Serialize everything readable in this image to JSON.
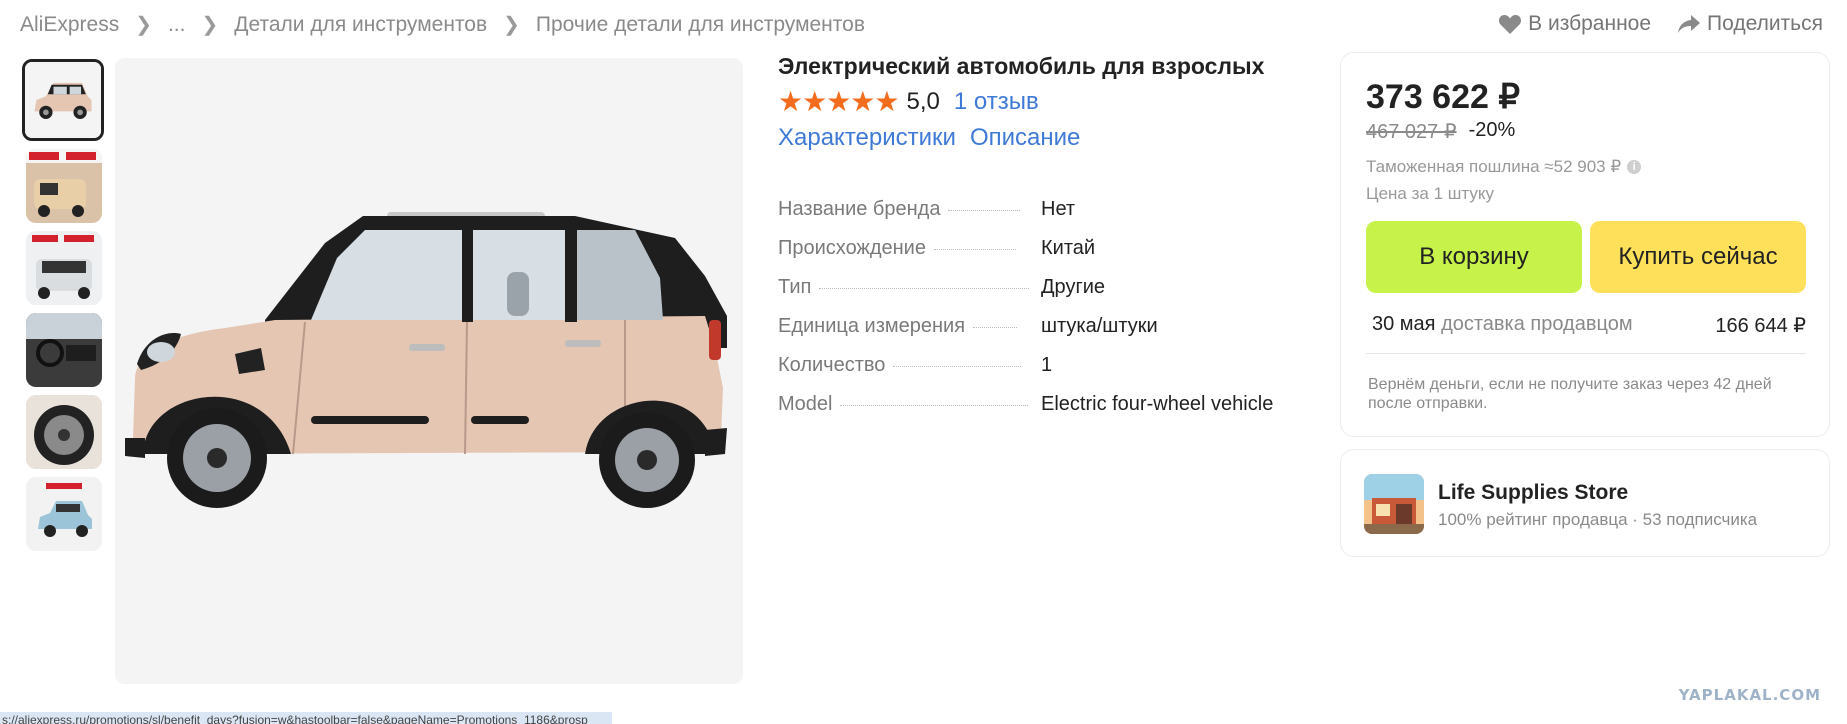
{
  "breadcrumb": {
    "items": [
      "AliExpress",
      "...",
      "Детали для инструментов",
      "Прочие детали для инструментов"
    ]
  },
  "header_actions": {
    "favorite_label": "В избранное",
    "share_label": "Поделиться"
  },
  "gallery": {
    "thumbnail_count": 6,
    "active_index": 0
  },
  "product": {
    "title": "Электрический автомобиль для взрослых",
    "stars": "★★★★★",
    "rating": "5,0",
    "reviews": "1 отзыв",
    "tabs": [
      "Характеристики",
      "Описание"
    ],
    "specs": [
      {
        "key": "Название бренда",
        "value": "Нет"
      },
      {
        "key": "Происхождение",
        "value": "Китай"
      },
      {
        "key": "Тип",
        "value": "Другие"
      },
      {
        "key": "Единица измерения",
        "value": "штука/штуки"
      },
      {
        "key": "Количество",
        "value": "1"
      },
      {
        "key": "Model",
        "value": "Electric four-wheel vehicle"
      }
    ]
  },
  "pricing": {
    "price": "373 622 ₽",
    "old_price": "467 027 ₽",
    "discount": "-20%",
    "customs_duty": "Таможенная пошлина ≈52 903 ₽",
    "info_icon_glyph": "i",
    "unit_price_note": "Цена за 1 штуку",
    "add_to_cart_label": "В корзину",
    "buy_now_label": "Купить сейчас",
    "delivery_date": "30 мая",
    "delivery_by": "доставка продавцом",
    "delivery_cost": "166 644 ₽",
    "refund_note": "Вернём деньги, если не получите заказ через 42 дней после отправки."
  },
  "store": {
    "name": "Life Supplies Store",
    "meta": "100% рейтинг продавца · 53 подписчика"
  },
  "watermark": "YAPLAKAL.COM",
  "status_bar_url": "s://aliexpress.ru/promotions/sl/benefit_days?fusion=w&hastoolbar=false&pageName=Promotions_1186&prosp",
  "colors": {
    "link_blue": "#3f7ad6",
    "star_orange": "#f36b1c",
    "cart_green": "#c6f24a",
    "buy_yellow": "#ffe05a",
    "car_body": "#e5c6b3"
  }
}
